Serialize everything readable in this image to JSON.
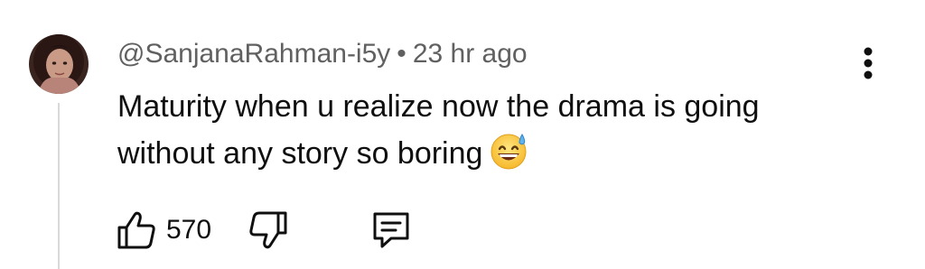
{
  "comment": {
    "author": "@SanjanaRahman-i5y",
    "separator": "•",
    "timestamp": "23 hr ago",
    "text": "Maturity when u realize now the drama is going without any story so boring",
    "emoji": "grinning-face-with-sweat"
  },
  "actions": {
    "like_count": "570",
    "like_icon": "thumbs-up-icon",
    "dislike_icon": "thumbs-down-icon",
    "reply_icon": "comment-icon",
    "menu_icon": "more-vertical-icon"
  },
  "colors": {
    "text": "#0f0f0f",
    "meta": "#606060",
    "thread_line": "#d9d9d9",
    "background": "#ffffff"
  }
}
